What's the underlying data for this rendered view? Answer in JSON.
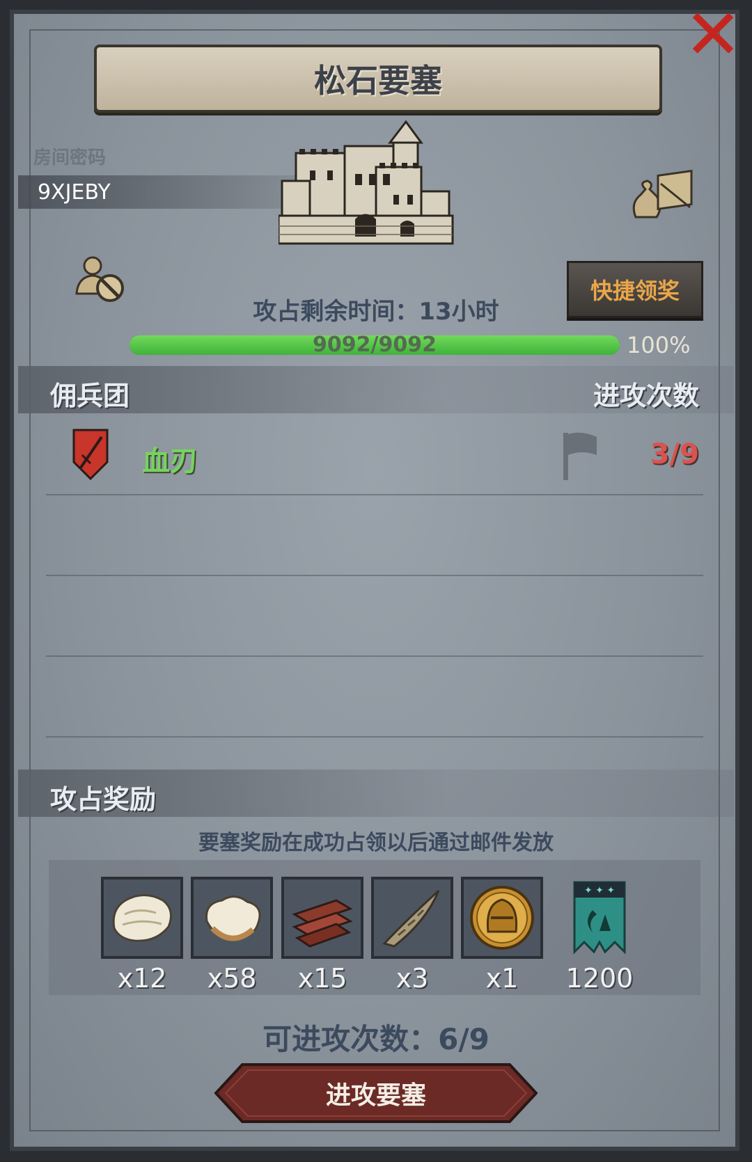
{
  "header": {
    "title": "松石要塞",
    "close_icon": "close-icon"
  },
  "room": {
    "label": "房间密码",
    "code": "9XJEBY"
  },
  "buttons": {
    "quick_claim": "快捷领奖",
    "attack": "进攻要塞"
  },
  "status": {
    "remaining_time": "攻占剩余时间：13小时",
    "progress_text": "9092/9092",
    "progress_percent": "100%",
    "progress_fraction": 1.0
  },
  "mercenaries": {
    "section_title": "佣兵团",
    "count_header": "进攻次数",
    "rows": [
      {
        "name": "血刃",
        "attacks": "3/9"
      }
    ]
  },
  "rewards": {
    "section_title": "攻占奖励",
    "note": "要塞奖励在成功占领以后通过邮件发放",
    "items": [
      {
        "icon": "fur-pelt-icon",
        "qty": "x12"
      },
      {
        "icon": "wool-fleece-icon",
        "qty": "x58"
      },
      {
        "icon": "wood-planks-icon",
        "qty": "x15"
      },
      {
        "icon": "twisted-horn-icon",
        "qty": "x3"
      },
      {
        "icon": "knight-helmet-coin-icon",
        "qty": "x1"
      },
      {
        "icon": "guild-banner-icon",
        "qty": "1200"
      }
    ]
  },
  "footer": {
    "available_attacks": "可进攻次数：6/9"
  },
  "colors": {
    "panel_bg": "#8b939c",
    "progress_green": "#4fc045",
    "merc_name_green": "#76d35e",
    "attack_count_red": "#d9544f",
    "quick_claim_orange": "#e9a64a",
    "close_red": "#c4261f"
  }
}
